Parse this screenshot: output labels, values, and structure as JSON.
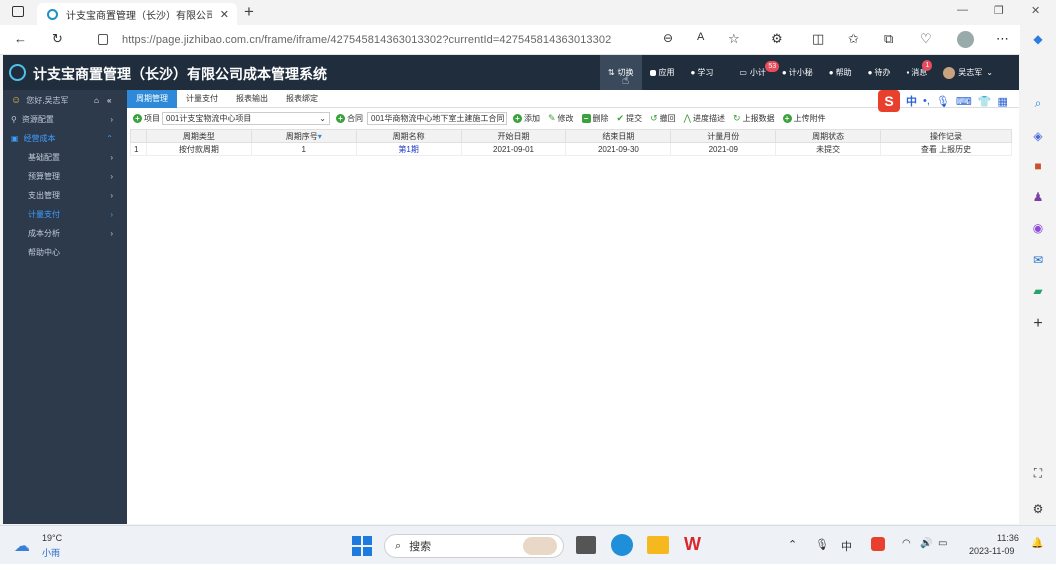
{
  "browser": {
    "tab_title": "计支宝商置管理（长沙）有限公司",
    "url": "https://page.jizhibao.com.cn/frame/iframe/427545814363013302?currentId=427545814363013302"
  },
  "app": {
    "title": "计支宝商置管理（长沙）有限公司成本管理系统",
    "nav": [
      {
        "label": "切换",
        "icon": "switch-icon"
      },
      {
        "label": "应用",
        "icon": "apps-icon"
      },
      {
        "label": "学习",
        "icon": "learn-icon"
      },
      {
        "label": "小计",
        "icon": "chat-icon",
        "badge": "53"
      },
      {
        "label": "计小秘",
        "icon": "assistant-icon"
      },
      {
        "label": "帮助",
        "icon": "help-icon"
      },
      {
        "label": "待办",
        "icon": "bell-icon"
      },
      {
        "label": "消息",
        "icon": "message-icon",
        "badge": "1"
      },
      {
        "label": "吴志军",
        "icon": "user-avatar"
      }
    ]
  },
  "sidebar": {
    "greeting": "您好,吴志军",
    "items": [
      {
        "label": "资源配置",
        "icon": "org-icon"
      },
      {
        "label": "经营成本",
        "icon": "cost-icon",
        "selected": true
      },
      {
        "label": "基础配置",
        "sub": true
      },
      {
        "label": "预算管理",
        "sub": true
      },
      {
        "label": "支出管理",
        "sub": true
      },
      {
        "label": "计量支付",
        "sub": true,
        "active": true
      },
      {
        "label": "成本分析",
        "sub": true
      },
      {
        "label": "帮助中心",
        "sub": true
      }
    ]
  },
  "tabs": [
    "周期管理",
    "计量支付",
    "报表输出",
    "报表绑定"
  ],
  "toolbar": {
    "project_label": "项目",
    "project_value": "001计支宝物流中心项目",
    "contract_label": "合同",
    "contract_value": "001华商物流中心地下室土建施工合同",
    "buttons": [
      "添加",
      "修改",
      "删除",
      "提交",
      "撤回",
      "进度描述",
      "上报数据",
      "上传附件"
    ]
  },
  "table": {
    "headers": [
      "周期类型",
      "周期序号",
      "周期名称",
      "开始日期",
      "结束日期",
      "计量月份",
      "周期状态",
      "操作记录"
    ],
    "rows": [
      {
        "num": "1",
        "cells": [
          "按付款周期",
          "1",
          "第1期",
          "2021-09-01",
          "2021-09-30",
          "2021-09",
          "未提交",
          "查看   上报历史"
        ]
      }
    ]
  },
  "taskbar": {
    "temp": "19°C",
    "weather": "小雨",
    "search": "搜索",
    "ime": "中",
    "time": "11:36",
    "date": "2023-11-09"
  }
}
